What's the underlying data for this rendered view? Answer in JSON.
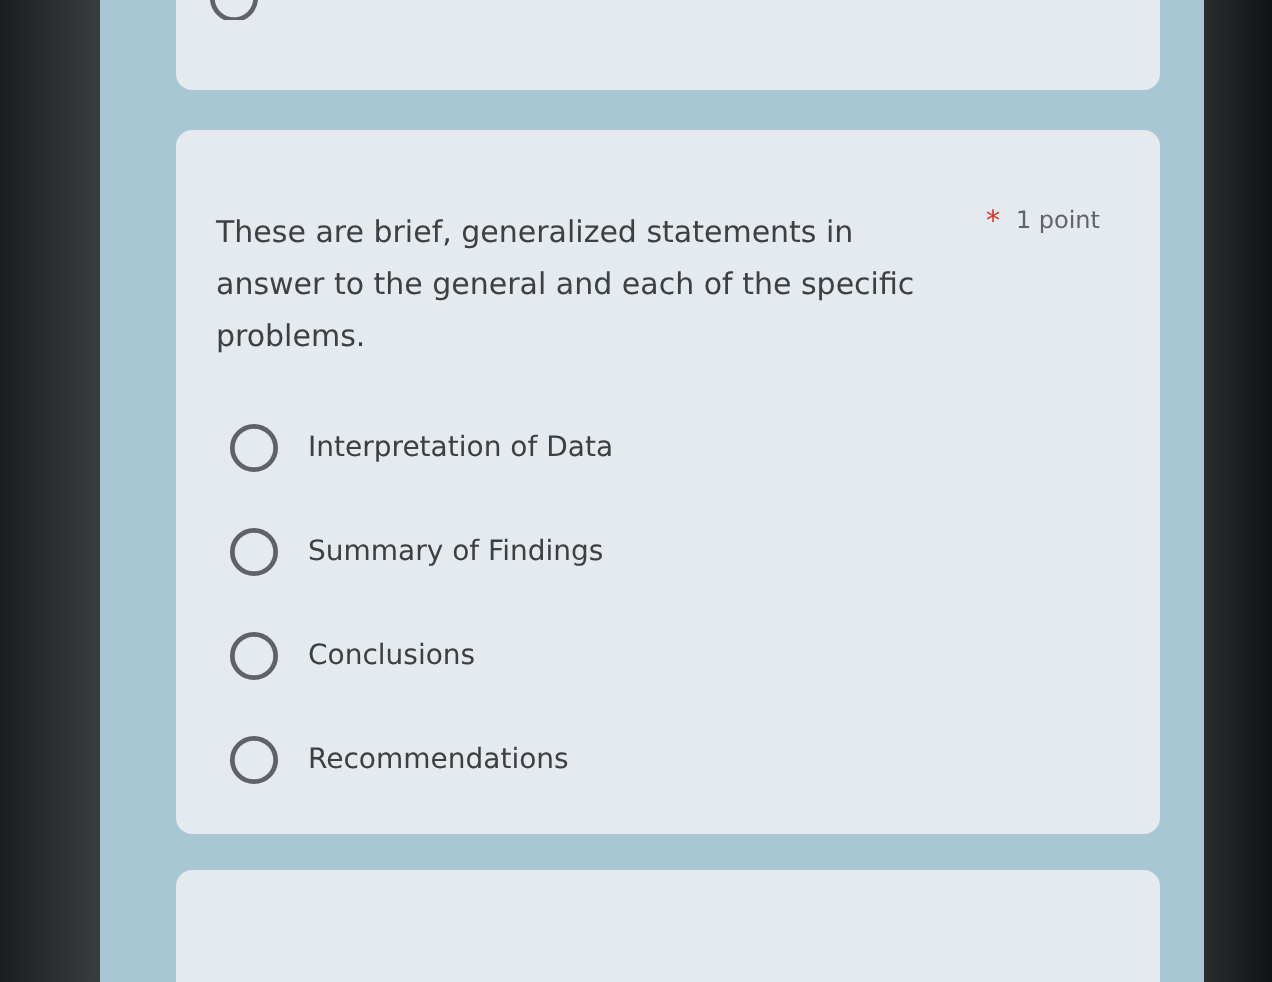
{
  "previous_card": {
    "options": [
      {
        "selected": false
      }
    ]
  },
  "question": {
    "text": "These are brief, generalized statements in answer to the general and each of the specific problems.",
    "required_mark": "*",
    "points": "1 point",
    "options": [
      {
        "label": "Interpretation of Data",
        "selected": false
      },
      {
        "label": "Summary of Findings",
        "selected": false
      },
      {
        "label": "Conclusions",
        "selected": false
      },
      {
        "label": "Recommendations",
        "selected": false
      }
    ]
  }
}
